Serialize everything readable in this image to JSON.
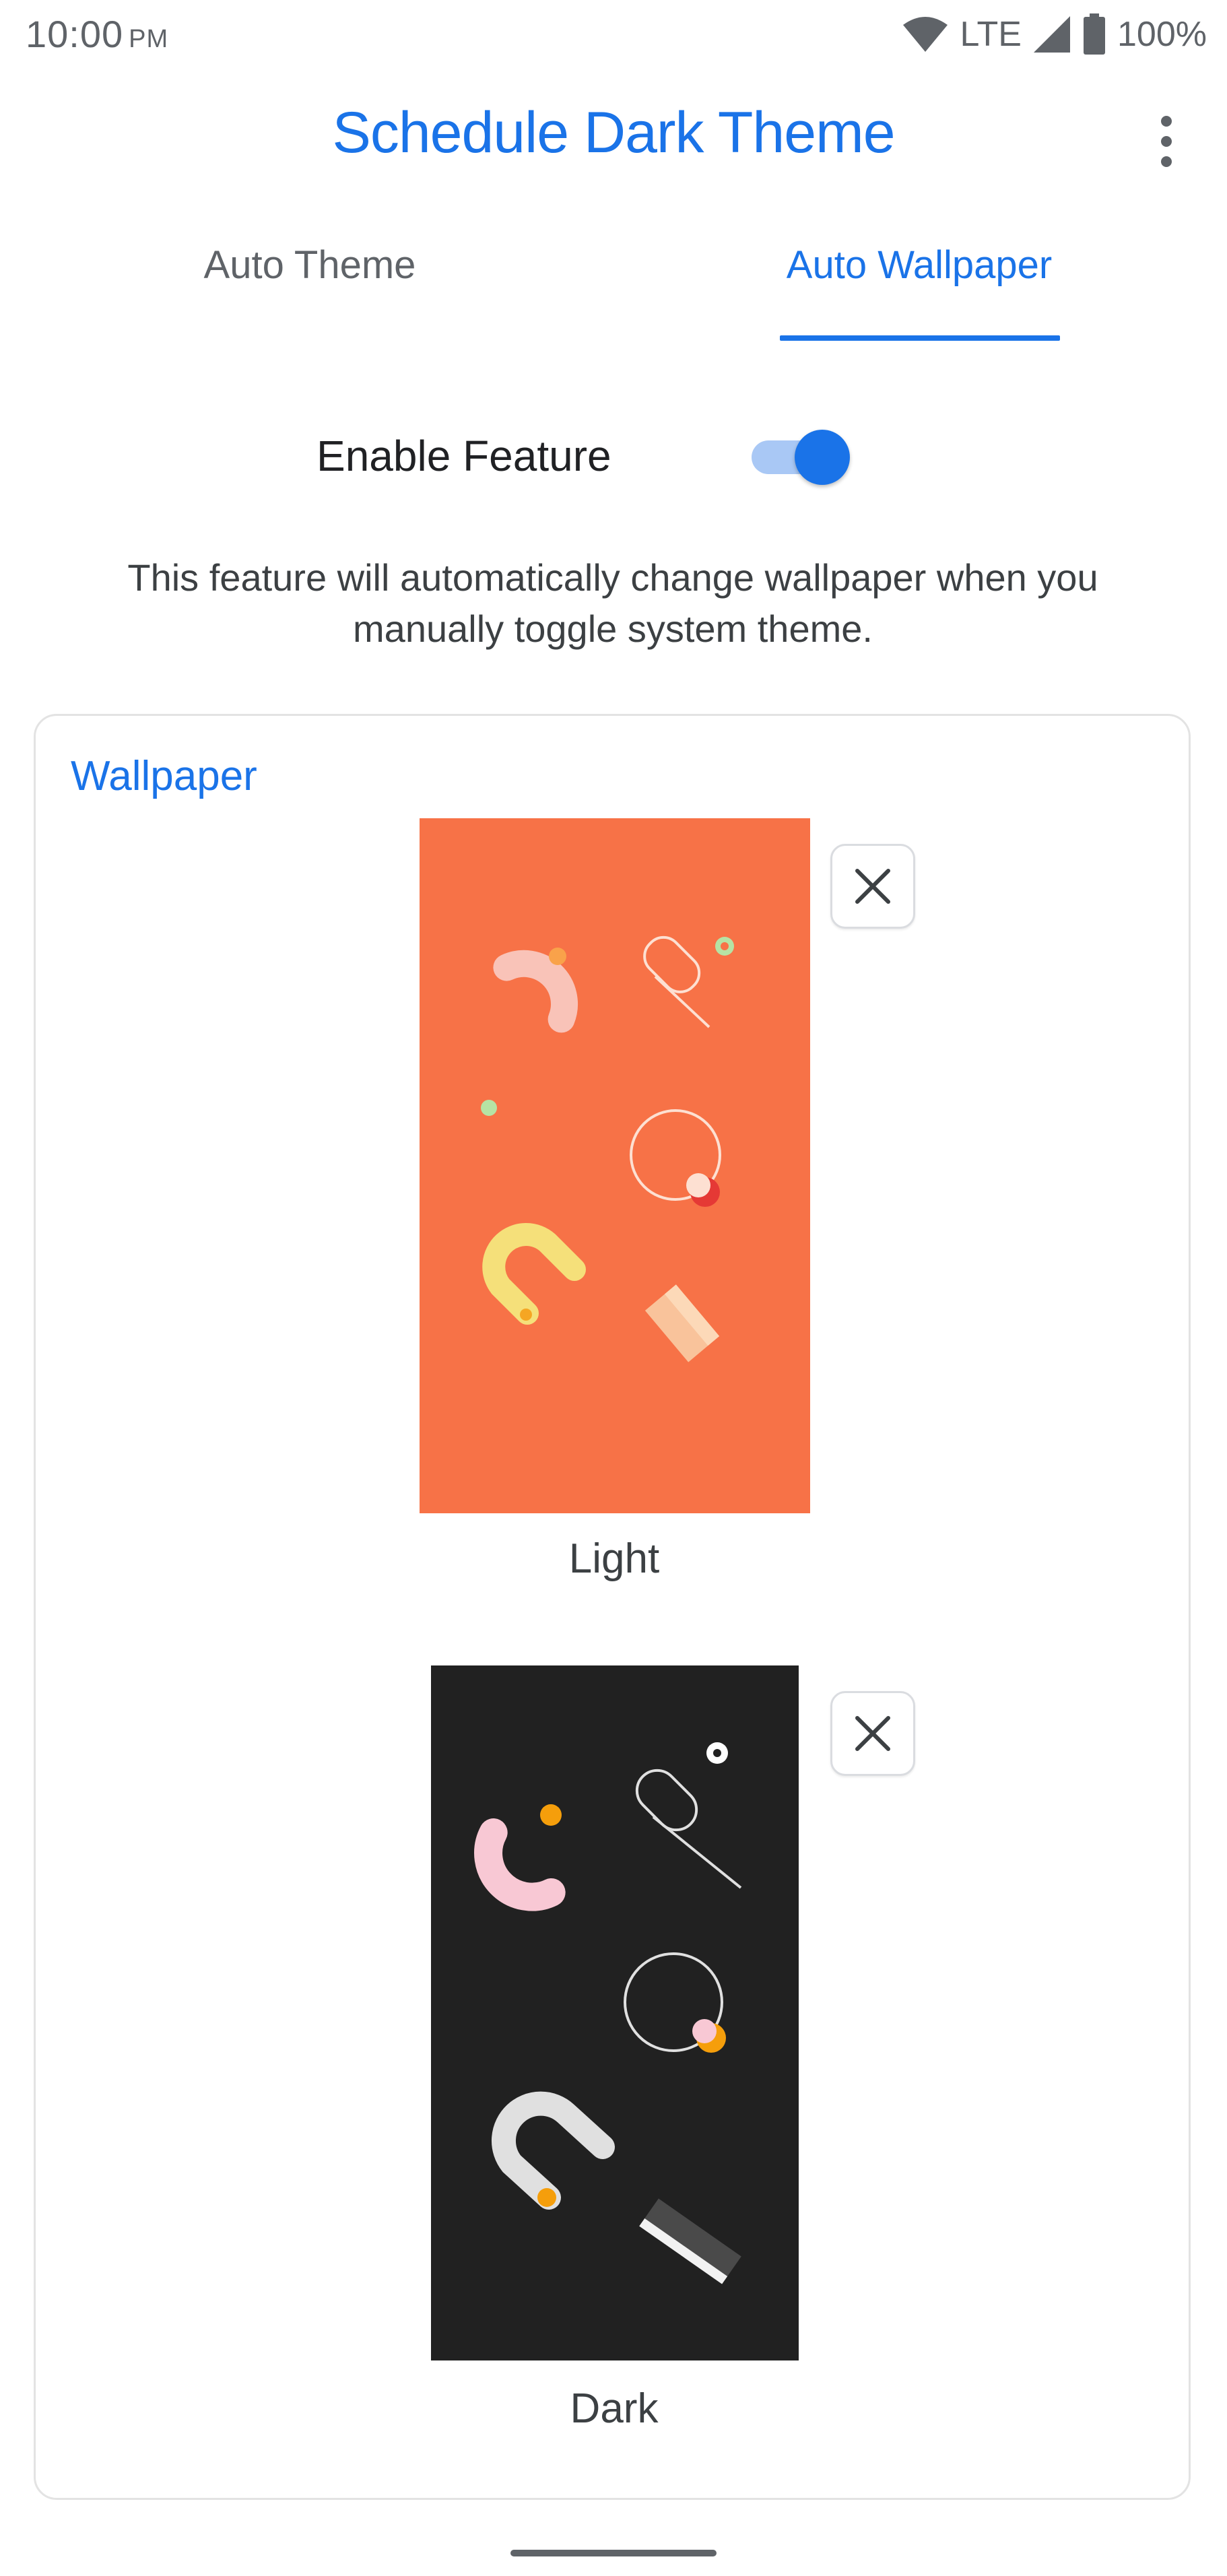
{
  "status_bar": {
    "time": "10:00",
    "ampm": "PM",
    "network": "LTE",
    "battery": "100%",
    "icons": [
      "wifi-icon",
      "cellular-signal-icon",
      "battery-icon"
    ]
  },
  "app_bar": {
    "title": "Schedule Dark Theme",
    "menu_icon": "more-vert-icon"
  },
  "tabs": [
    {
      "label": "Auto Theme",
      "selected": false
    },
    {
      "label": "Auto Wallpaper",
      "selected": true
    }
  ],
  "feature": {
    "label": "Enable Feature",
    "enabled": true,
    "description": "This feature will automatically change wallpaper when you manually toggle system theme."
  },
  "wallpaper_card": {
    "title": "Wallpaper",
    "items": [
      {
        "caption": "Light",
        "background": "#f77247",
        "remove_icon": "close-icon"
      },
      {
        "caption": "Dark",
        "background": "#212121",
        "remove_icon": "close-icon"
      }
    ]
  },
  "colors": {
    "accent": "#1a73e8",
    "toggle_track": "#a9c8f5"
  }
}
